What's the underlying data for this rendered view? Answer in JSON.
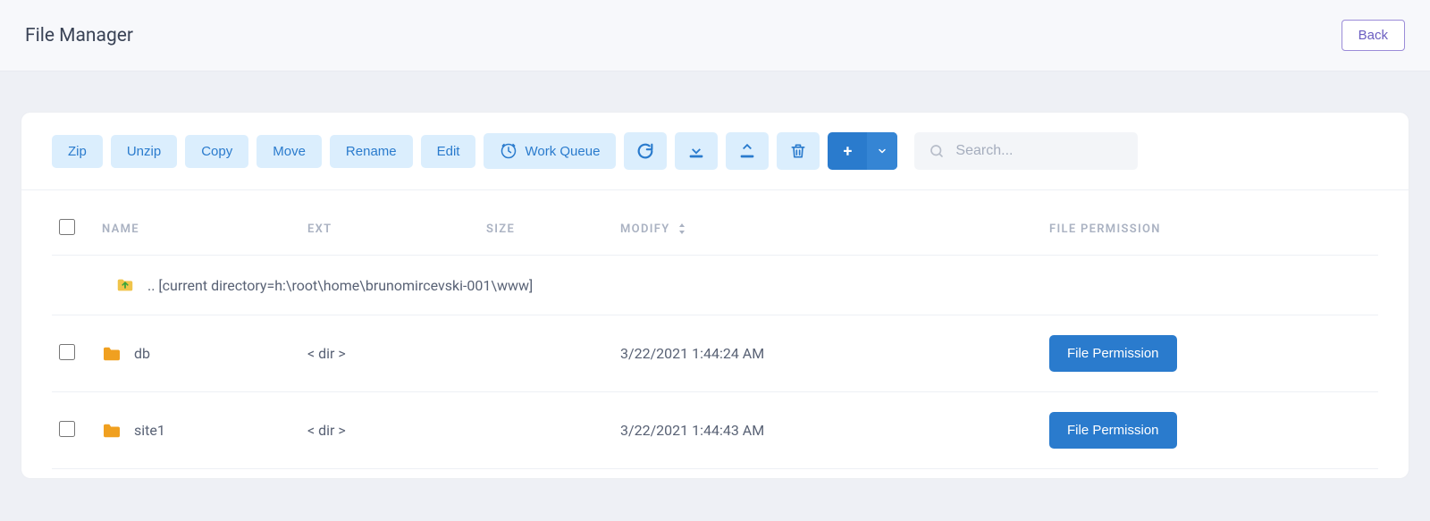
{
  "header": {
    "title": "File Manager",
    "back_label": "Back"
  },
  "toolbar": {
    "zip": "Zip",
    "unzip": "Unzip",
    "copy": "Copy",
    "move": "Move",
    "rename": "Rename",
    "edit": "Edit",
    "work_queue": "Work Queue",
    "search_placeholder": "Search..."
  },
  "table": {
    "headers": {
      "name": "NAME",
      "ext": "EXT",
      "size": "SIZE",
      "modify": "MODIFY",
      "permission": "FILE PERMISSION"
    },
    "up_directory_label": ".. [current directory=h:\\root\\home\\brunomircevski-001\\www]",
    "file_permission_button": "File Permission",
    "rows": [
      {
        "name": "db",
        "ext": "< dir >",
        "size": "",
        "modify": "3/22/2021 1:44:24 AM"
      },
      {
        "name": "site1",
        "ext": "< dir >",
        "size": "",
        "modify": "3/22/2021 1:44:43 AM"
      }
    ]
  }
}
